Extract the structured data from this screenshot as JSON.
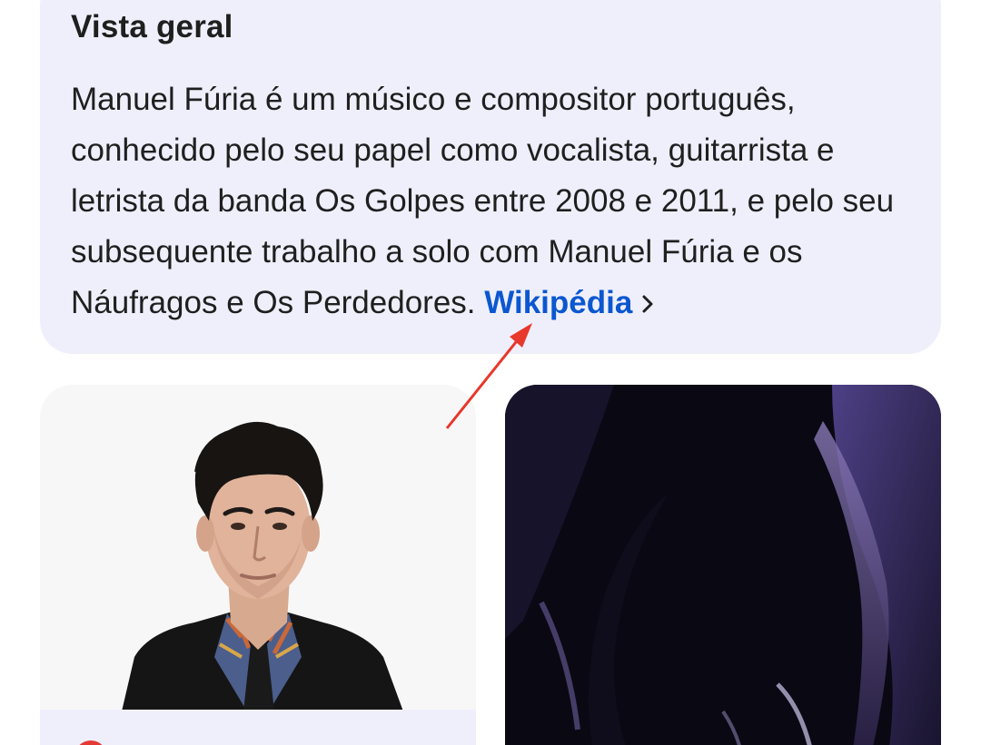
{
  "overview": {
    "title": "Vista geral",
    "body": "Manuel Fúria é um músico e compositor português, conhecido pelo seu papel como vocalista, guitarrista e letrista da banda Os Golpes entre 2008 e 2011, e pelo seu subsequente trabalho a solo com Manuel Fúria e os Náufragos e Os Perdedores.",
    "source_link": "Wikipédia",
    "link_color": "#0b57d0",
    "card_color": "#efeffc"
  },
  "images": {
    "left": {
      "icon": "person-photo"
    },
    "right": {
      "icon": "dark-abstract-photo"
    },
    "source_icon_color": "#e53935"
  },
  "annotation": {
    "icon": "red-arrow-icon",
    "color": "#e8372b"
  }
}
